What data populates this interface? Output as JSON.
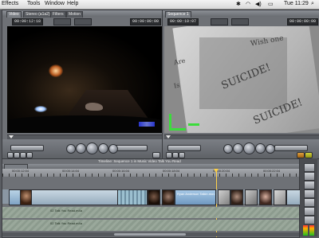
{
  "menubar": {
    "items": [
      "Effects",
      "Tools",
      "Window",
      "Help"
    ],
    "clock": "Tue 11:29"
  },
  "viewer": {
    "tabs": [
      "Video",
      "Stereo (a1a2)",
      "Filters",
      "Motion"
    ],
    "timecode_left": "00:00:12:18",
    "timecode_right": "00:00:00:00"
  },
  "canvas": {
    "tab": "Sequence 1",
    "timecode_left": "00:00:10:07",
    "timecode_right": "00:00:00:00",
    "paper_words": [
      "Wish one",
      "Are",
      "Is",
      "SUICIDE!"
    ]
  },
  "timeline": {
    "title": "Timeline: Sequence 1 in Music Video Talk You Read",
    "ruler_ticks": [
      "00:00:12:04",
      "00:00:14:04",
      "00:00:16:04",
      "00:00:18:04",
      "00:00:20:04",
      "00:00:22:04"
    ],
    "audio_clip_labels": [
      "02 Talk You Read.m4a",
      "02 Talk You Read.m4a"
    ],
    "video_clip_label": "Ryan Anderson Talkin.mov",
    "playhead_timecode": "00:00:10:07"
  }
}
